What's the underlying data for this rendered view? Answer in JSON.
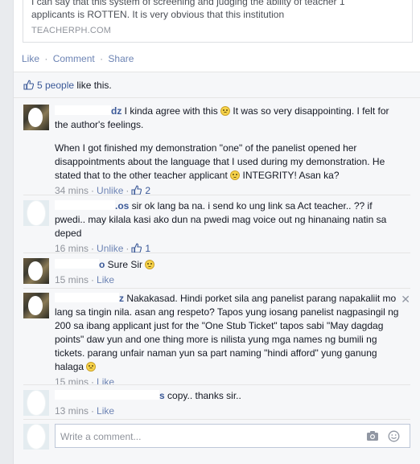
{
  "post": {
    "link_desc_line1": "I can say that this system of screening and judging the ability of teacher 1",
    "link_desc_line2": "applicants is ROTTEN. It is very obvious that this institution",
    "link_domain": "TEACHERPH.COM",
    "actions": {
      "like": "Like",
      "comment": "Comment",
      "share": "Share",
      "sep": "·"
    }
  },
  "likes": {
    "count_text": "5 people",
    "suffix": " like this."
  },
  "comments": [
    {
      "author_tail": "dz",
      "text1_a": " I kinda agree with this ",
      "text1_b": " It was so very disappointing. I felt for the author's feelings.",
      "text2_a": "When I got finished my demonstration \"one\" of the panelist opened her disappointments about the language that I used during my demonstration. He stated that to the other teacher applicant ",
      "text2_b": " INTEGRITY! Asan ka?",
      "time": "34 mins",
      "unlike": "Unlike",
      "likes": "2"
    },
    {
      "author_tail": ".os",
      "text": " sir ok lang ba na. i send ko ung link sa Act teacher.. ?? if pwedi.. may kilala kasi ako dun na pwedi mag voice out ng hinanaing natin sa deped",
      "time": "16 mins",
      "unlike": "Unlike",
      "likes": "1"
    },
    {
      "author_tail": "o",
      "text": " Sure Sir ",
      "time": "15 mins",
      "like": "Like"
    },
    {
      "author_tail": "z",
      "text_a": " Nakakasad. Hindi porket sila ang panelist parang napakaliit mo lang sa tingin nila. asan ang respeto? Tapos yung iosang panelist nagpasingil ng 200 sa ibang applicant just for the \"One Stub Ticket\" tapos sabi \"May dagdag points\" daw yun and one thing more is nilista yung mga names ng bumili ng tickets. parang unfair naman yun sa part naming \"hindi afford\" yung ganung halaga ",
      "time": "15 mins",
      "like": "Like",
      "close": "✕"
    },
    {
      "author_tail": "s",
      "text": " copy.. thanks sir..",
      "time": "13 mins",
      "like": "Like"
    }
  ],
  "composer": {
    "placeholder": "Write a comment..."
  },
  "icons": {
    "thumb": "thumbs-up-icon",
    "smiley": "smiley-icon",
    "camera": "camera-icon",
    "emoji": "emoji-icon",
    "close": "close-icon"
  },
  "colors": {
    "link": "#3b5998",
    "meta": "#90949c",
    "action": "#6d84b4"
  }
}
